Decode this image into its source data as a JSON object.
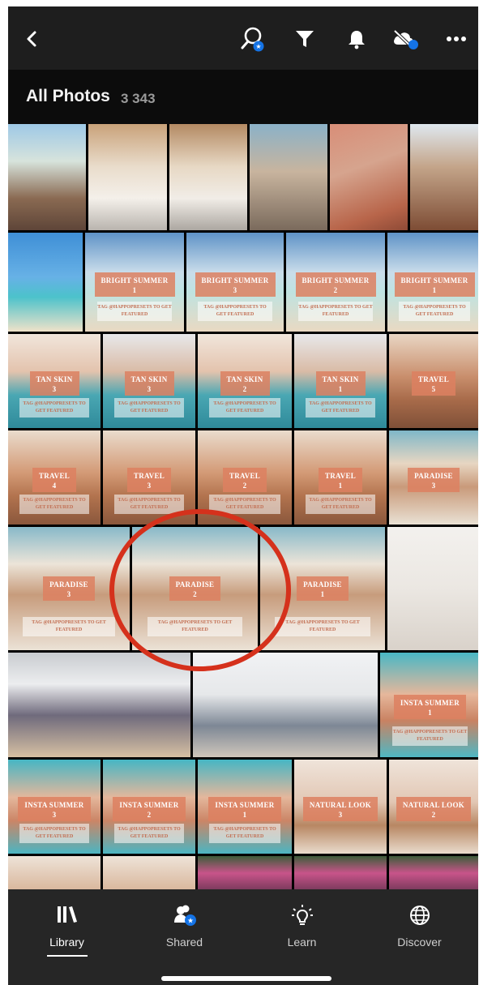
{
  "header": {
    "title": "All Photos",
    "count": "3 343"
  },
  "toolbar": {
    "icons": [
      "back-icon",
      "search-people-icon",
      "filter-icon",
      "bell-icon",
      "cloud-sync-off-icon",
      "more-icon"
    ],
    "accent": "#1473e6"
  },
  "grid": {
    "rows": [
      {
        "h": 131,
        "tiles": [
          {
            "w": 96,
            "bg": "linear-gradient(180deg,#9ec9e6 0%,#d7e3dc 35%,#8a6a52 70%,#5e4538 100%)"
          },
          {
            "w": 97,
            "bg": "linear-gradient(180deg,#c9a27a 0%,#e9dccb 40%,#f4f0ea 70%,#b9b4ae 100%)"
          },
          {
            "w": 96,
            "bg": "linear-gradient(180deg,#b48a63 0%,#e7d8c4 40%,#f1ede7 70%,#aca7a1 100%)"
          },
          {
            "w": 96,
            "bg": "linear-gradient(180deg,#8bb2c8 0%,#c8b49e 45%,#7a6a5c 100%)"
          },
          {
            "w": 96,
            "bg": "linear-gradient(160deg,#d88e78 0%,#d6a48e 40%,#b8654a 80%,#8e4a36 100%)"
          },
          {
            "w": 91,
            "bg": "linear-gradient(180deg,#dfe8ef 0%,#c4a58a 40%,#7d4c34 100%)"
          }
        ]
      },
      {
        "h": 122,
        "tiles": [
          {
            "w": 92,
            "bg": "linear-gradient(180deg,#3f8fd6 0%,#67b1e6 45%,#4cc2cb 65%,#efe2c9 100%)"
          },
          {
            "w": 122,
            "bg": "linear-gradient(180deg,#5f93c7 0%,#c9dcea 40%,#bfe3e1 60%,#e9d9c2 100%)",
            "label": "BRIGHT SUMMER",
            "num": "1",
            "tag": "TAG @HAPPOPRESETS TO GET FEATURED"
          },
          {
            "w": 120,
            "bg": "linear-gradient(180deg,#5f93c7 0%,#c9dcea 40%,#bfe3e1 60%,#e9d9c2 100%)",
            "label": "BRIGHT SUMMER",
            "num": "3",
            "tag": "TAG @HAPPOPRESETS TO GET FEATURED"
          },
          {
            "w": 122,
            "bg": "linear-gradient(180deg,#5f93c7 0%,#c9dcea 40%,#bfe3e1 60%,#e9d9c2 100%)",
            "label": "BRIGHT SUMMER",
            "num": "2",
            "tag": "TAG @HAPPOPRESETS TO GET FEATURED"
          },
          {
            "w": 116,
            "bg": "linear-gradient(180deg,#5f93c7 0%,#c9dcea 40%,#bfe3e1 60%,#e9d9c2 100%)",
            "label": "BRIGHT SUMMER",
            "num": "1",
            "tag": "TAG @HAPPOPRESETS TO GET FEATURED"
          }
        ]
      },
      {
        "h": 116,
        "tiles": [
          {
            "w": 114,
            "bg": "linear-gradient(180deg,#f1e6dc 0%,#e3c3ad 40%,#4aa7b3 65%,#2f8a9a 100%)",
            "label": "TAN SKIN",
            "num": "3",
            "tag": "TAG @HAPPOPRESETS TO GET FEATURED"
          },
          {
            "w": 114,
            "bg": "linear-gradient(180deg,#e8e8ea 0%,#d9bba6 40%,#4aa7b3 65%,#2f8a9a 100%)",
            "label": "TAN SKIN",
            "num": "3",
            "tag": "TAG @HAPPOPRESETS TO GET FEATURED"
          },
          {
            "w": 116,
            "bg": "linear-gradient(180deg,#f1e6dc 0%,#e3c3ad 40%,#4aa7b3 65%,#2f8a9a 100%)",
            "label": "TAN SKIN",
            "num": "2",
            "tag": "TAG @HAPPOPRESETS TO GET FEATURED"
          },
          {
            "w": 114,
            "bg": "linear-gradient(180deg,#e8e8ea 0%,#d9bba6 40%,#4aa7b3 65%,#2f8a9a 100%)",
            "label": "TAN SKIN",
            "num": "1",
            "tag": "TAG @HAPPOPRESETS TO GET FEATURED"
          },
          {
            "w": 110,
            "bg": "linear-gradient(180deg,#e9d6c4 0%,#c98f6d 45%,#a86b4a 70%,#7f5038 100%)",
            "label": "TRAVEL",
            "num": "5"
          }
        ]
      },
      {
        "h": 116,
        "tiles": [
          {
            "w": 114,
            "bg": "linear-gradient(180deg,#eadccd 0%,#d39a76 45%,#b2734e 70%,#8a573c 100%)",
            "label": "TRAVEL",
            "num": "4",
            "tag": "TAG @HAPPOPRESETS TO GET FEATURED"
          },
          {
            "w": 114,
            "bg": "linear-gradient(180deg,#eadccd 0%,#d39a76 45%,#b2734e 70%,#8a573c 100%)",
            "label": "TRAVEL",
            "num": "3",
            "tag": "TAG @HAPPOPRESETS TO GET FEATURED"
          },
          {
            "w": 116,
            "bg": "linear-gradient(180deg,#eadccd 0%,#d39a76 45%,#b2734e 70%,#8a573c 100%)",
            "label": "TRAVEL",
            "num": "2",
            "tag": "TAG @HAPPOPRESETS TO GET FEATURED"
          },
          {
            "w": 114,
            "bg": "linear-gradient(180deg,#eadccd 0%,#d39a76 45%,#b2734e 70%,#8a573c 100%)",
            "label": "TRAVEL",
            "num": "1",
            "tag": "TAG @HAPPOPRESETS TO GET FEATURED"
          },
          {
            "w": 110,
            "bg": "linear-gradient(180deg,#7fb7c8 0%,#e7d6c2 35%,#c99a7a 60%,#e9e1d4 100%)",
            "label": "PARADISE",
            "num": "3"
          }
        ]
      },
      {
        "h": 152,
        "tiles": [
          {
            "w": 150,
            "bg": "linear-gradient(180deg,#88b9c9 0%,#ece4d8 30%,#c79c7c 55%,#ebe2d6 100%)",
            "label": "PARADISE",
            "num": "3",
            "tag": "TAG @HAPPOPRESETS TO GET FEATURED"
          },
          {
            "w": 155,
            "bg": "linear-gradient(180deg,#88b9c9 0%,#ece4d8 30%,#c79c7c 55%,#ebe2d6 100%)",
            "label": "PARADISE",
            "num": "2",
            "tag": "TAG @HAPPOPRESETS TO GET FEATURED"
          },
          {
            "w": 154,
            "bg": "linear-gradient(180deg,#88b9c9 0%,#ece4d8 30%,#c79c7c 55%,#ebe2d6 100%)",
            "label": "PARADISE",
            "num": "1",
            "tag": "TAG @HAPPOPRESETS TO GET FEATURED"
          },
          {
            "w": 112,
            "bg": "linear-gradient(180deg,#f3f1ee 0%,#ebe7e2 50%,#d9d2ca 100%)"
          }
        ]
      },
      {
        "h": 129,
        "tiles": [
          {
            "w": 225,
            "bg": "linear-gradient(180deg,#c9ccd0 0%,#ecedef 30%,#6f6a7c 60%,#d6c0a3 100%)"
          },
          {
            "w": 228,
            "bg": "linear-gradient(180deg,#f1f2f4 0%,#e6e8ea 40%,#7d8795 70%,#cfc6bb 100%)"
          },
          {
            "w": 123,
            "bg": "linear-gradient(180deg,#49b7c5 0%,#e6b79b 40%,#c98262 65%,#4eb7c4 100%)",
            "label": "INSTA SUMMER",
            "num": "1",
            "tag": "TAG @HAPPOPRESETS TO GET FEATURED"
          }
        ]
      },
      {
        "h": 116,
        "tiles": [
          {
            "w": 114,
            "bg": "linear-gradient(180deg,#46b6c4 0%,#e4b79c 40%,#cb8566 65%,#4bb5c2 100%)",
            "label": "INSTA SUMMER",
            "num": "3",
            "tag": "TAG @HAPPOPRESETS TO GET FEATURED"
          },
          {
            "w": 114,
            "bg": "linear-gradient(180deg,#46b6c4 0%,#e4b79c 40%,#cb8566 65%,#4bb5c2 100%)",
            "label": "INSTA SUMMER",
            "num": "2",
            "tag": "TAG @HAPPOPRESETS TO GET FEATURED"
          },
          {
            "w": 116,
            "bg": "linear-gradient(180deg,#46b6c4 0%,#e4b79c 40%,#cb8566 65%,#4bb5c2 100%)",
            "label": "INSTA SUMMER",
            "num": "1",
            "tag": "TAG @HAPPOPRESETS TO GET FEATURED"
          },
          {
            "w": 114,
            "bg": "linear-gradient(180deg,#efe4da 0%,#e2c7b4 45%,#b88763 70%,#e9dccd 100%)",
            "label": "NATURAL LOOK",
            "num": "3"
          },
          {
            "w": 110,
            "bg": "linear-gradient(180deg,#efe4da 0%,#e2c7b4 45%,#b88763 70%,#e9dccd 100%)",
            "label": "NATURAL LOOK",
            "num": "2"
          }
        ]
      },
      {
        "h": 42,
        "tiles": [
          {
            "w": 114,
            "bg": "linear-gradient(180deg,#eee3d8 0%,#d9b79c 100%)"
          },
          {
            "w": 114,
            "bg": "linear-gradient(180deg,#eee3d8 0%,#d9b79c 100%)"
          },
          {
            "w": 116,
            "bg": "linear-gradient(180deg,#3d5d3a 0%,#c8548a 50%,#7b3a5c 100%)"
          },
          {
            "w": 114,
            "bg": "linear-gradient(180deg,#3d5d3a 0%,#c8548a 50%,#7b3a5c 100%)"
          },
          {
            "w": 110,
            "bg": "linear-gradient(180deg,#3d5d3a 0%,#c8548a 50%,#7b3a5c 100%)"
          }
        ]
      }
    ]
  },
  "tabs": [
    {
      "label": "Library",
      "icon": "library-icon",
      "active": true
    },
    {
      "label": "Shared",
      "icon": "shared-people-icon",
      "active": false
    },
    {
      "label": "Learn",
      "icon": "lightbulb-icon",
      "active": false
    },
    {
      "label": "Discover",
      "icon": "globe-icon",
      "active": false
    }
  ]
}
